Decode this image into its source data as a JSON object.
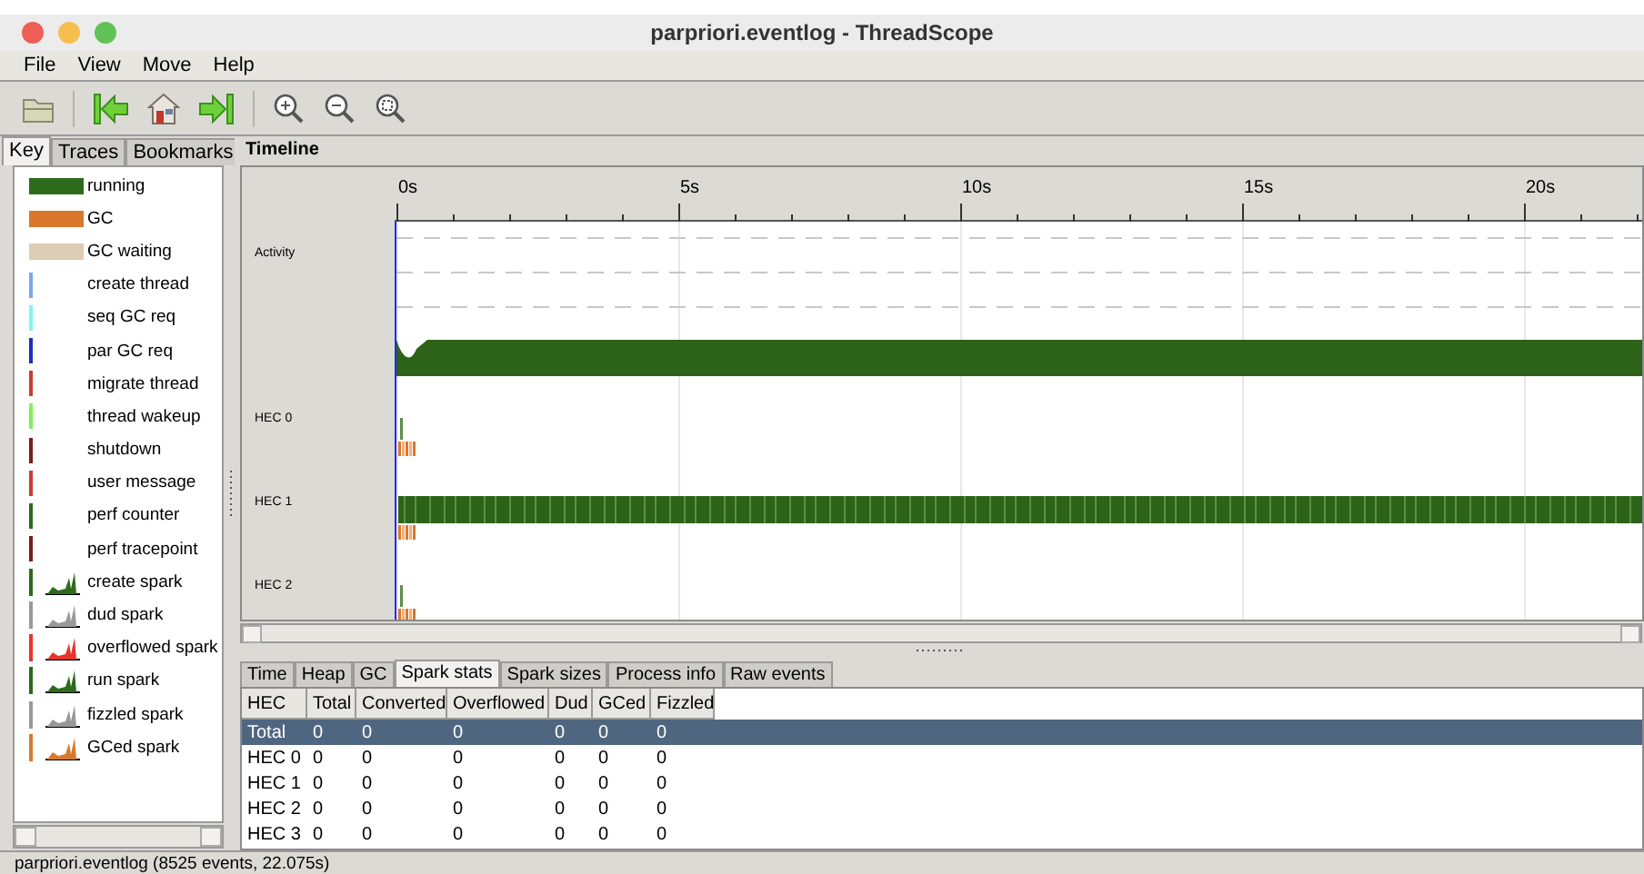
{
  "window": {
    "title": "parpriori.eventlog - ThreadScope"
  },
  "menu": [
    "File",
    "View",
    "Move",
    "Help"
  ],
  "side_tabs": [
    {
      "label": "Key",
      "selected": true
    },
    {
      "label": "Traces",
      "selected": false
    },
    {
      "label": "Bookmarks",
      "selected": false
    }
  ],
  "key": [
    {
      "label": "running",
      "kind": "bar",
      "color": "#2d6a1b"
    },
    {
      "label": "GC",
      "kind": "bar",
      "color": "#d9782c"
    },
    {
      "label": "GC waiting",
      "kind": "bar",
      "color": "#dccdb4"
    },
    {
      "label": "create thread",
      "kind": "line",
      "color": "#7aa7f0"
    },
    {
      "label": "seq GC req",
      "kind": "line",
      "color": "#7ff5f7"
    },
    {
      "label": "par GC req",
      "kind": "line",
      "color": "#1a2fc0"
    },
    {
      "label": "migrate thread",
      "kind": "line",
      "color": "#cc3b30"
    },
    {
      "label": "thread wakeup",
      "kind": "line",
      "color": "#7ef158"
    },
    {
      "label": "shutdown",
      "kind": "line",
      "color": "#7b1d1d"
    },
    {
      "label": "user message",
      "kind": "line",
      "color": "#cc3b30"
    },
    {
      "label": "perf counter",
      "kind": "line",
      "color": "#2d6a1b"
    },
    {
      "label": "perf tracepoint",
      "kind": "line",
      "color": "#7b1d1d"
    },
    {
      "label": "create spark",
      "kind": "spark",
      "color": "#2d6a1b"
    },
    {
      "label": "dud spark",
      "kind": "spark",
      "color": "#999999"
    },
    {
      "label": "overflowed spark",
      "kind": "spark",
      "color": "#e8332c"
    },
    {
      "label": "run spark",
      "kind": "spark",
      "color": "#2d6a1b"
    },
    {
      "label": "fizzled spark",
      "kind": "spark",
      "color": "#999999"
    },
    {
      "label": "GCed spark",
      "kind": "spark",
      "color": "#d9782c"
    }
  ],
  "timeline": {
    "title": "Timeline",
    "ticks": [
      "0s",
      "5s",
      "10s",
      "15s",
      "20s"
    ],
    "tracks": [
      {
        "label": "Activity",
        "kind": "activity",
        "running": true
      },
      {
        "label": "HEC 0",
        "kind": "hec",
        "running": false
      },
      {
        "label": "HEC 1",
        "kind": "hec",
        "running": true
      },
      {
        "label": "HEC 2",
        "kind": "hec",
        "running": false
      }
    ]
  },
  "bottom_tabs": [
    {
      "label": "Time",
      "selected": false
    },
    {
      "label": "Heap",
      "selected": false
    },
    {
      "label": "GC",
      "selected": false
    },
    {
      "label": "Spark stats",
      "selected": true
    },
    {
      "label": "Spark sizes",
      "selected": false
    },
    {
      "label": "Process info",
      "selected": false
    },
    {
      "label": "Raw events",
      "selected": false
    }
  ],
  "table": {
    "columns": [
      "HEC",
      "Total",
      "Converted",
      "Overflowed",
      "Dud",
      "GCed",
      "Fizzled"
    ],
    "rows": [
      {
        "cells": [
          "Total",
          "0",
          "0",
          "0",
          "0",
          "0",
          "0"
        ],
        "selected": true
      },
      {
        "cells": [
          "HEC 0",
          "0",
          "0",
          "0",
          "0",
          "0",
          "0"
        ],
        "selected": false
      },
      {
        "cells": [
          "HEC 1",
          "0",
          "0",
          "0",
          "0",
          "0",
          "0"
        ],
        "selected": false
      },
      {
        "cells": [
          "HEC 2",
          "0",
          "0",
          "0",
          "0",
          "0",
          "0"
        ],
        "selected": false
      },
      {
        "cells": [
          "HEC 3",
          "0",
          "0",
          "0",
          "0",
          "0",
          "0"
        ],
        "selected": false
      }
    ]
  },
  "status_bar": "parpriori.eventlog (8525 events, 22.075s)"
}
